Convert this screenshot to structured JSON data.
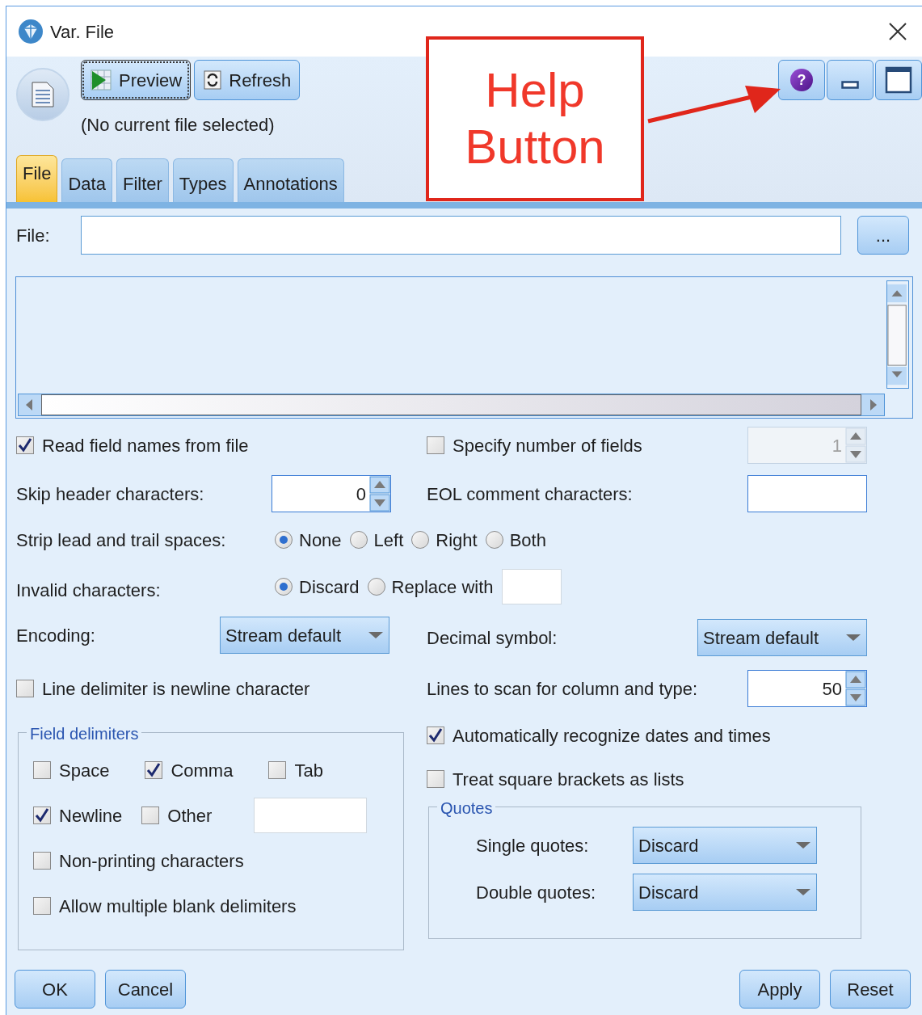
{
  "window": {
    "title": "Var. File"
  },
  "toolbar": {
    "buttons": [
      {
        "kind": "preview",
        "label": "Preview"
      },
      {
        "kind": "refresh",
        "label": "Refresh"
      }
    ],
    "status": "(No current file selected)",
    "window_buttons": [
      {
        "kind": "help",
        "text": "?"
      },
      {
        "kind": "minimize"
      },
      {
        "kind": "maximize"
      }
    ]
  },
  "tabs": [
    {
      "label": "File",
      "selected": true
    },
    {
      "label": "Data",
      "selected": false
    },
    {
      "label": "Filter",
      "selected": false
    },
    {
      "label": "Types",
      "selected": false
    },
    {
      "label": "Annotations",
      "selected": false
    }
  ],
  "file": {
    "label": "File:",
    "browse_label": "..."
  },
  "read_field_names": {
    "label": "Read field names from file",
    "checked": true
  },
  "specify_number": {
    "label": "Specify number of fields",
    "checked": false,
    "value": "1",
    "disabled": true
  },
  "skip_header": {
    "label": "Skip header characters:",
    "value": "0"
  },
  "eol_comment": {
    "label": "EOL comment characters:"
  },
  "strip_spaces": {
    "label": "Strip lead and trail spaces:",
    "options": [
      {
        "label": "None",
        "selected": true
      },
      {
        "label": "Left",
        "selected": false
      },
      {
        "label": "Right",
        "selected": false
      },
      {
        "label": "Both",
        "selected": false
      }
    ]
  },
  "invalid_characters": {
    "label": "Invalid characters:",
    "options": [
      {
        "label": "Discard",
        "selected": true
      },
      {
        "label": "Replace with",
        "selected": false
      }
    ]
  },
  "encoding": {
    "label": "Encoding:",
    "value": "Stream default"
  },
  "decimal_symbol": {
    "label": "Decimal symbol:",
    "value": "Stream default"
  },
  "line_delimiter": {
    "label": "Line delimiter is newline character",
    "checked": false
  },
  "lines_to_scan": {
    "label": "Lines to scan for column and type:",
    "value": "50"
  },
  "field_delimiters": {
    "title": "Field delimiters",
    "items": [
      {
        "label": "Space",
        "checked": false
      },
      {
        "label": "Comma",
        "checked": true
      },
      {
        "label": "Tab",
        "checked": false
      },
      {
        "label": "Newline",
        "checked": true
      },
      {
        "label": "Other",
        "checked": false
      },
      {
        "label": "Non-printing characters",
        "checked": false
      },
      {
        "label": "Allow multiple blank delimiters",
        "checked": false
      }
    ]
  },
  "auto_dates": {
    "label": "Automatically recognize dates and times",
    "checked": true
  },
  "square_brackets": {
    "label": "Treat square brackets as lists",
    "checked": false
  },
  "quotes": {
    "title": "Quotes",
    "rows": [
      {
        "label": "Single quotes:",
        "value": "Discard"
      },
      {
        "label": "Double quotes:",
        "value": "Discard"
      }
    ]
  },
  "buttons_left": [
    "OK",
    "Cancel"
  ],
  "buttons_right": [
    "Apply",
    "Reset"
  ],
  "annotation": {
    "text": "Help Button"
  }
}
